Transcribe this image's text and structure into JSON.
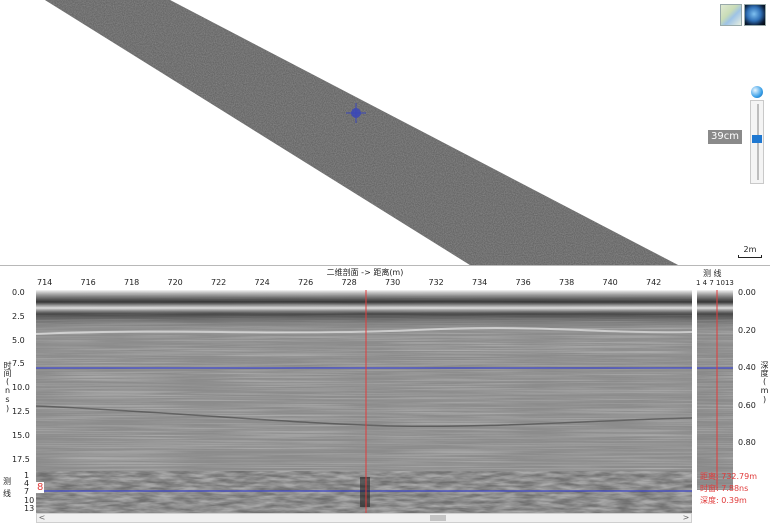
{
  "map": {
    "zoom_label": "39cm",
    "scale_label": "2m",
    "icons": [
      "map-thumbnail-icon",
      "globe-icon",
      "zoom-handle-icon",
      "crosshair-icon"
    ]
  },
  "profile": {
    "x_title": "二维剖面 -> 距离(m)",
    "x_ticks": [
      "714",
      "716",
      "718",
      "720",
      "722",
      "724",
      "726",
      "728",
      "730",
      "732",
      "734",
      "736",
      "738",
      "740",
      "742"
    ],
    "y_title": "时间(ns)",
    "y_ticks": [
      "0.0",
      "2.5",
      "5.0",
      "7.5",
      "10.0",
      "12.5",
      "15.0",
      "17.5"
    ],
    "depth_title": "深度(m)",
    "depth_ticks": [
      "0.00",
      "0.20",
      "0.40",
      "0.60",
      "0.80"
    ],
    "lines_title": "测 线",
    "side_ticks": "1 4 7 1013",
    "track_label": "测线",
    "track_ticks": [
      "1",
      "4",
      "7",
      "10",
      "13"
    ],
    "track_current": "8",
    "readouts": {
      "distance": "距离: 732.79m",
      "window": "时窗: 7.88ns",
      "depth": "深度: 0.39m"
    },
    "scroll": {
      "left_icon": "<",
      "right_icon": ">"
    },
    "colors": {
      "cursor": "#e23b3b",
      "horizon": "#3b44c8",
      "readout": "#e03a3a"
    }
  }
}
